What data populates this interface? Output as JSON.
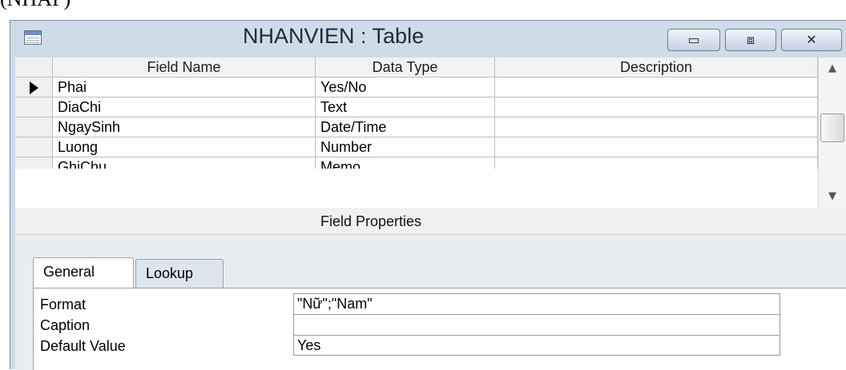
{
  "caption_text": "(NHAP)",
  "window": {
    "title": "NHANVIEN : Table",
    "controls": {
      "minimize": "▭",
      "maximize": "⧈",
      "close": "✕"
    }
  },
  "grid": {
    "headers": [
      "Field Name",
      "Data Type",
      "Description"
    ],
    "rows": [
      {
        "field": "Phai",
        "type": "Yes/No",
        "desc": ""
      },
      {
        "field": "DiaChi",
        "type": "Text",
        "desc": ""
      },
      {
        "field": "NgaySinh",
        "type": "Date/Time",
        "desc": ""
      },
      {
        "field": "Luong",
        "type": "Number",
        "desc": ""
      },
      {
        "field": "GhiChu",
        "type": "Memo",
        "desc": ""
      }
    ]
  },
  "field_properties": {
    "title": "Field Properties",
    "tabs": [
      "General",
      "Lookup"
    ],
    "selected_tab": "General",
    "properties": [
      {
        "label": "Format",
        "value": "\"Nữ\";\"Nam\""
      },
      {
        "label": "Caption",
        "value": ""
      },
      {
        "label": "Default Value",
        "value": "Yes"
      }
    ]
  }
}
